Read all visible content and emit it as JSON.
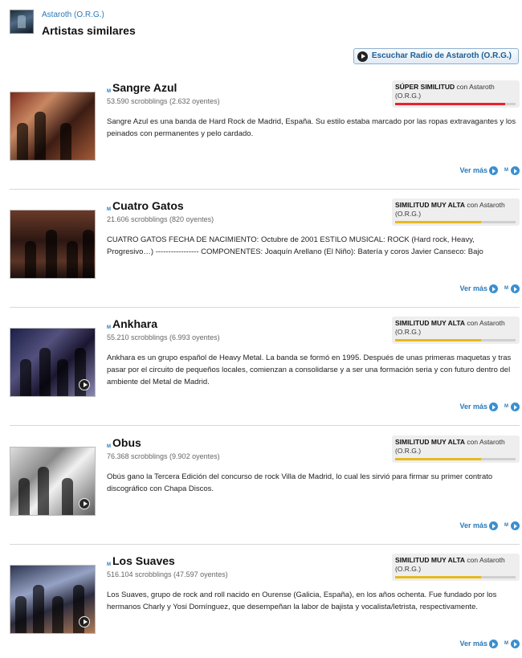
{
  "header": {
    "artist_link": "Astaroth (O.R.G.)",
    "title": "Artistas similares",
    "radio_button": "Escuchar Radio de Astaroth (O.R.G.)"
  },
  "colors": {
    "link": "#2a79b8",
    "bar_super": "#e8222c",
    "bar_high": "#e6b91e",
    "bar_track": "#cfcfcf"
  },
  "common": {
    "more_label": "Ver más",
    "similarity_suffix": "con Astaroth (O.R.G.)",
    "m_icon": "M"
  },
  "artists": [
    {
      "name": "Sangre Azul",
      "stats": "53.590 scrobblings (2.632 oyentes)",
      "similarity": "SÚPER SIMILITUD",
      "similarity_fraction": 0.91,
      "bar_color": "#e8222c",
      "bio": "Sangre Azul es una banda de Hard Rock de Madrid, España. Su estilo estaba marcado por las ropas extravagantes y los peinados con permanentes y pelo cardado.",
      "has_play_overlay": false
    },
    {
      "name": "Cuatro Gatos",
      "stats": "21.606 scrobblings (820 oyentes)",
      "similarity": "SIMILITUD MUY ALTA",
      "similarity_fraction": 0.71,
      "bar_color": "#e6b91e",
      "bio": "CUATRO GATOS FECHA DE NACIMIENTO: Octubre de 2001 ESTILO MUSICAL: ROCK (Hard rock, Heavy, Progresivo…) ----------------- COMPONENTES: Joaquín Arellano (El Niño): Batería y coros Javier Canseco: Bajo",
      "has_play_overlay": false
    },
    {
      "name": "Ankhara",
      "stats": "55.210 scrobblings (6.993 oyentes)",
      "similarity": "SIMILITUD MUY ALTA",
      "similarity_fraction": 0.71,
      "bar_color": "#e6b91e",
      "bio": "Ankhara es un grupo español de Heavy Metal. La banda se formó en 1995. Después de unas primeras maquetas y tras pasar por el circuito de pequeños locales, comienzan a consolidarse y a ser una formación seria y con futuro dentro del ambiente del Metal de Madrid.",
      "has_play_overlay": true
    },
    {
      "name": "Obus",
      "stats": "76.368 scrobblings (9.902 oyentes)",
      "similarity": "SIMILITUD MUY ALTA",
      "similarity_fraction": 0.71,
      "bar_color": "#e6b91e",
      "bio": "Obús gano la Tercera Edición del concurso de rock Villa de Madrid, lo cual les sirvió para firmar su primer contrato discográfico con Chapa Discos.",
      "has_play_overlay": true
    },
    {
      "name": "Los Suaves",
      "stats": "516.104 scrobblings (47.597 oyentes)",
      "similarity": "SIMILITUD MUY ALTA",
      "similarity_fraction": 0.71,
      "bar_color": "#e6b91e",
      "bio": "Los Suaves, grupo de rock and roll nacido en Ourense (Galicia, España), en los años ochenta. Fue fundado por los hermanos Charly y Yosi Domínguez, que desempeñan la labor de bajista y vocalista/letrista, respectivamente.",
      "has_play_overlay": true
    }
  ]
}
